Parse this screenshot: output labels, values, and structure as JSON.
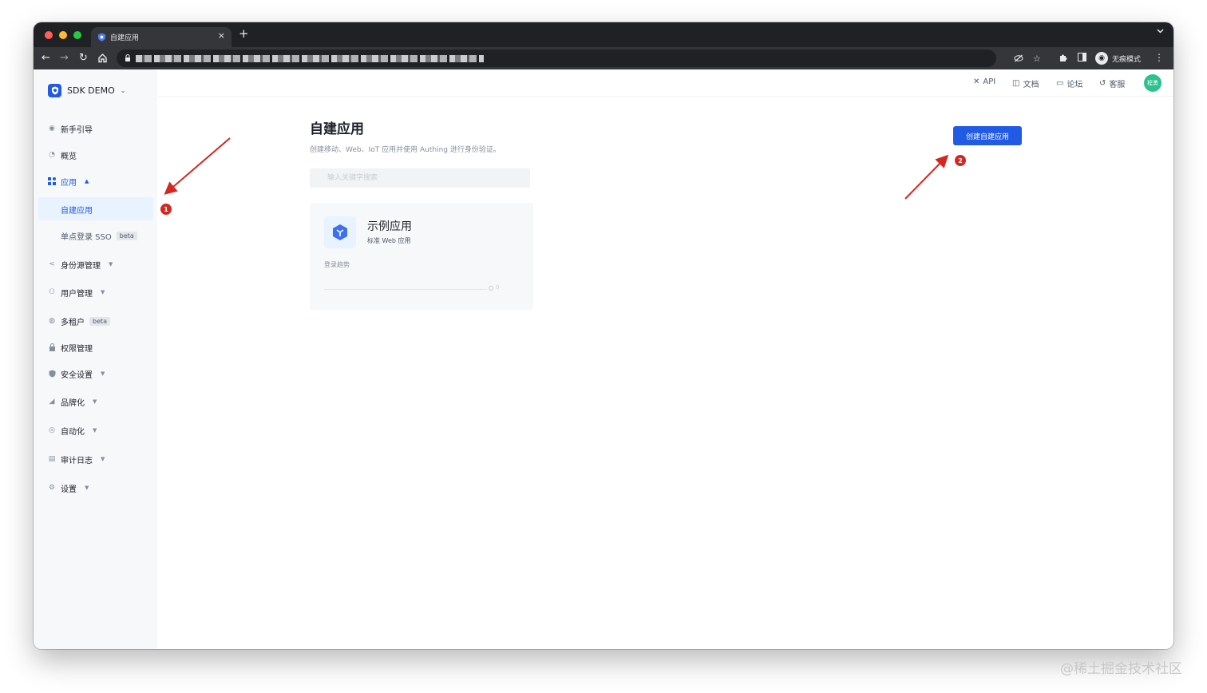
{
  "browser": {
    "tab_title": "自建应用",
    "tab_close": "×",
    "new_tab": "+",
    "incognito_label": "无痕模式"
  },
  "sidebar": {
    "brand_name": "SDK DEMO",
    "items": [
      {
        "label": "新手引导"
      },
      {
        "label": "概览"
      },
      {
        "label": "应用"
      },
      {
        "label": "身份源管理"
      },
      {
        "label": "用户管理"
      },
      {
        "label": "多租户",
        "badge": "beta"
      },
      {
        "label": "权限管理"
      },
      {
        "label": "安全设置"
      },
      {
        "label": "品牌化"
      },
      {
        "label": "自动化"
      },
      {
        "label": "审计日志"
      },
      {
        "label": "设置"
      }
    ],
    "sub_items": [
      {
        "label": "自建应用"
      },
      {
        "label": "单点登录 SSO",
        "badge": "beta"
      }
    ]
  },
  "topnav": {
    "api": "API",
    "docs": "文档",
    "forum": "论坛",
    "support": "客服",
    "avatar_text": "程勇"
  },
  "main": {
    "title": "自建应用",
    "description": "创建移动、Web、IoT 应用并使用 Authing 进行身份验证。",
    "search_placeholder": "输入关键字搜索",
    "create_button": "创建自建应用",
    "app_card": {
      "name": "示例应用",
      "type": "标准 Web 应用",
      "trend_label": "登录趋势",
      "trend_value": "0"
    }
  },
  "annotations": {
    "marker_1": "1",
    "marker_2": "2",
    "arrow_color": "#d4271f"
  },
  "watermark": "@稀土掘金技术社区",
  "colors": {
    "primary": "#215ae5",
    "active_bg": "#e8f3ff",
    "avatar": "#2bc28f"
  }
}
